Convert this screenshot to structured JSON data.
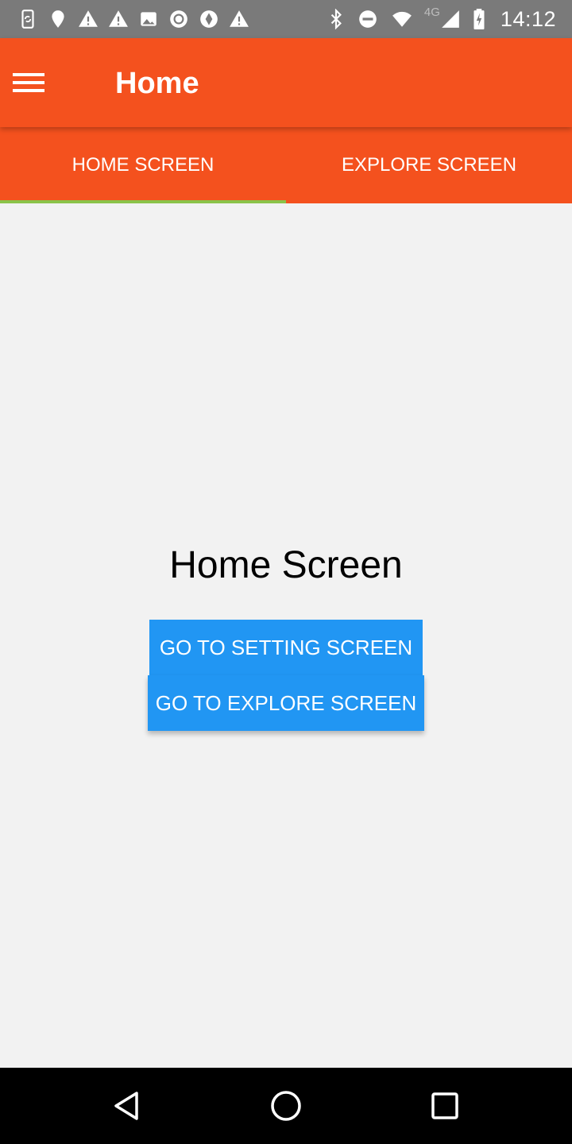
{
  "status_bar": {
    "time": "14:12",
    "network": "4G",
    "left_icons": [
      "sync-phone-icon",
      "location-pin-icon",
      "warning-icon",
      "warning-icon",
      "image-icon",
      "record-icon",
      "navigation-icon",
      "warning-icon"
    ],
    "right_icons": [
      "bluetooth-icon",
      "do-not-disturb-icon",
      "wifi-icon",
      "cell-signal-icon",
      "battery-charging-icon"
    ]
  },
  "app_bar": {
    "title": "Home",
    "menu_icon": "hamburger-menu-icon",
    "background_color": "#f4511e"
  },
  "tabs": [
    {
      "label": "HOME SCREEN",
      "selected": true
    },
    {
      "label": "EXPLORE SCREEN",
      "selected": false
    }
  ],
  "tab_indicator_color": "#8bc34a",
  "main": {
    "title": "Home Screen",
    "buttons": {
      "setting": "GO TO SETTING SCREEN",
      "explore": "GO TO EXPLORE SCREEN"
    },
    "button_color": "#2196f3"
  },
  "nav_bar": {
    "icons": [
      "back-icon",
      "home-icon",
      "recent-apps-icon"
    ]
  }
}
